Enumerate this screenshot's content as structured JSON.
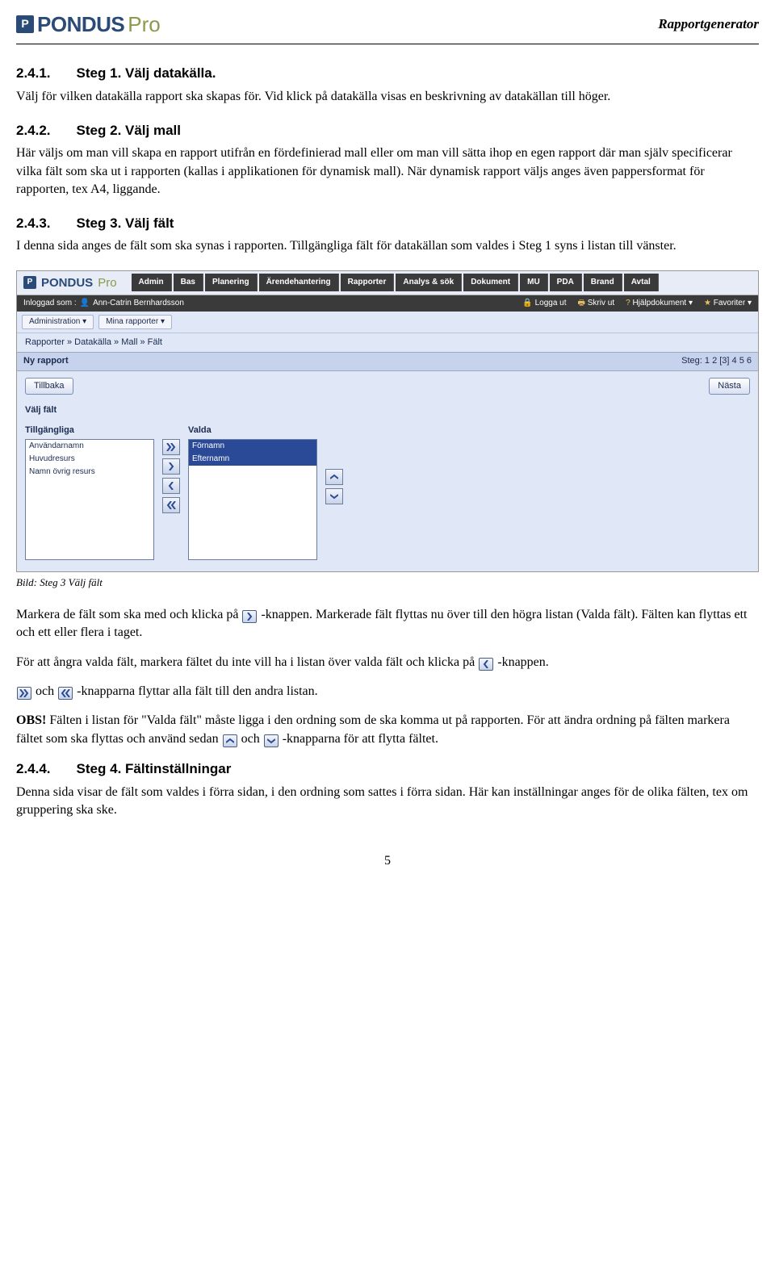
{
  "header": {
    "logo_text": "PONDUS",
    "logo_suffix": "Pro",
    "doc_title": "Rapportgenerator"
  },
  "sections": {
    "s1": {
      "num": "2.4.1.",
      "title": "Steg 1. Välj datakälla.",
      "body": "Välj för vilken datakälla rapport ska skapas för. Vid klick på datakälla visas en beskrivning av datakällan till höger."
    },
    "s2": {
      "num": "2.4.2.",
      "title": "Steg 2. Välj mall",
      "body": "Här väljs om man vill skapa en rapport utifrån en fördefinierad mall eller om man vill sätta ihop en egen rapport där man själv specificerar vilka fält som ska ut i rapporten (kallas i applikationen för dynamisk mall). När dynamisk rapport väljs anges även pappersformat för rapporten, tex A4, liggande."
    },
    "s3": {
      "num": "2.4.3.",
      "title": "Steg 3. Välj fält",
      "body": "I denna sida anges de fält som ska synas i rapporten. Tillgängliga fält för datakällan som valdes i Steg 1 syns i listan till vänster."
    },
    "s4": {
      "num": "2.4.4.",
      "title": "Steg 4. Fältinställningar",
      "body": "Denna sida visar de fält som valdes i förra sidan, i den ordning som sattes i förra sidan. Här kan inställningar anges för de olika fälten, tex om gruppering ska ske."
    }
  },
  "caption": "Bild: Steg 3 Välj fält",
  "post": {
    "p1a": "Markera de fält som ska med och klicka på ",
    "p1b": "-knappen. Markerade fält flyttas nu över till den högra listan (Valda fält). Fälten kan flyttas ett och ett eller flera i taget.",
    "p2a": "För att ångra valda fält, markera fältet du inte vill ha i listan över valda fält och klicka på ",
    "p2b": "-knappen.",
    "p3a": " och ",
    "p3b": "-knapparna flyttar alla fält till den andra listan.",
    "p4_obs": "OBS!",
    "p4a": " Fälten i listan för \"Valda fält\" måste ligga i den ordning som de ska komma ut på rapporten. För att ändra ordning på fälten markera fältet som ska flyttas och använd sedan ",
    "p4b": " och ",
    "p4c": " -knapparna för att flytta fältet."
  },
  "pagenum": "5",
  "app": {
    "brand": "PONDUS",
    "brand_suffix": "Pro",
    "menu": [
      "Admin",
      "Bas",
      "Planering",
      "Ärendehantering",
      "Rapporter",
      "Analys & sök",
      "Dokument",
      "MU",
      "PDA",
      "Brand",
      "Avtal"
    ],
    "login_label": "Inloggad som :",
    "user": "Ann-Catrin Bernhardsson",
    "toolbar": {
      "logout": "Logga ut",
      "print": "Skriv ut",
      "help": "Hjälpdokument",
      "fav": "Favoriter"
    },
    "tabs": [
      "Administration",
      "Mina rapporter"
    ],
    "crumbs": "Rapporter » Datakälla » Mall » Fält",
    "report_title": "Ny rapport",
    "step_label": "Steg: 1 2 [3] 4 5 6",
    "btn_back": "Tillbaka",
    "btn_next": "Nästa",
    "sec_title": "Välj fält",
    "col_available": "Tillgängliga",
    "col_selected": "Valda",
    "available_items": [
      "Användarnamn",
      "Huvudresurs",
      "Namn övrig resurs"
    ],
    "selected_items": [
      "Förnamn",
      "Efternamn"
    ]
  }
}
